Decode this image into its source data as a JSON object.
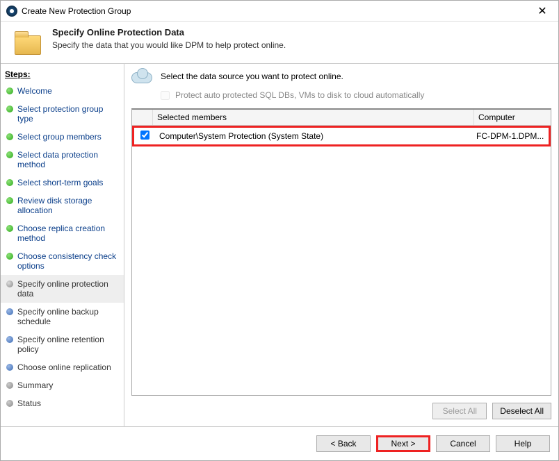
{
  "window": {
    "title": "Create New Protection Group"
  },
  "header": {
    "title": "Specify Online Protection Data",
    "subtitle": "Specify the data that you would like DPM to help protect online."
  },
  "sidebar": {
    "label": "Steps:",
    "items": [
      {
        "label": "Welcome",
        "state": "done",
        "link": true
      },
      {
        "label": "Select protection group type",
        "state": "done",
        "link": true
      },
      {
        "label": "Select group members",
        "state": "done",
        "link": true
      },
      {
        "label": "Select data protection method",
        "state": "done",
        "link": true
      },
      {
        "label": "Select short-term goals",
        "state": "done",
        "link": true
      },
      {
        "label": "Review disk storage allocation",
        "state": "done",
        "link": true
      },
      {
        "label": "Choose replica creation method",
        "state": "done",
        "link": true
      },
      {
        "label": "Choose consistency check options",
        "state": "done",
        "link": true
      },
      {
        "label": "Specify online protection data",
        "state": "current",
        "link": false
      },
      {
        "label": "Specify online backup schedule",
        "state": "pending",
        "link": false
      },
      {
        "label": "Specify online retention policy",
        "state": "pending",
        "link": false
      },
      {
        "label": "Choose online replication",
        "state": "pending",
        "link": false
      },
      {
        "label": "Summary",
        "state": "gray",
        "link": false
      },
      {
        "label": "Status",
        "state": "gray",
        "link": false
      }
    ]
  },
  "main": {
    "instruction": "Select the data source you want to protect online.",
    "auto_protect_checkbox_label": "Protect auto protected SQL DBs, VMs to disk to cloud automatically",
    "auto_protect_checked": false,
    "columns": {
      "checkbox": "",
      "members": "Selected members",
      "computer": "Computer"
    },
    "rows": [
      {
        "checked": true,
        "member": "Computer\\System Protection (System State)",
        "computer": "FC-DPM-1.DPM..."
      }
    ],
    "buttons": {
      "select_all": "Select All",
      "deselect_all": "Deselect All"
    }
  },
  "footer": {
    "back": "< Back",
    "next": "Next >",
    "cancel": "Cancel",
    "help": "Help"
  }
}
